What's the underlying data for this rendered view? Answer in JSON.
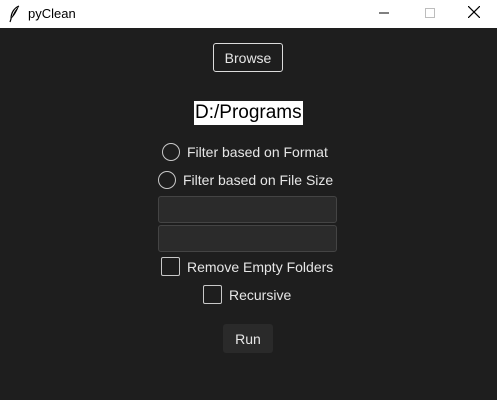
{
  "window": {
    "title": "pyClean",
    "app_icon": "feather-icon",
    "controls": [
      "minimize-icon",
      "maximize-icon",
      "close-icon"
    ]
  },
  "main": {
    "browse_label": "Browse",
    "path": "D:/Programs",
    "radio_format_label": "Filter based on Format",
    "radio_size_label": "Filter based on File Size",
    "entry_1_value": "",
    "entry_2_value": "",
    "check_empty_label": "Remove Empty Folders",
    "check_recursive_label": "Recursive",
    "run_label": "Run"
  },
  "colors": {
    "background": "#1e1e1e",
    "titlebar": "#ffffff",
    "text": "#dcdcdc",
    "entry_bg": "#2b2b2b",
    "run_bg": "#2a2a2a"
  }
}
